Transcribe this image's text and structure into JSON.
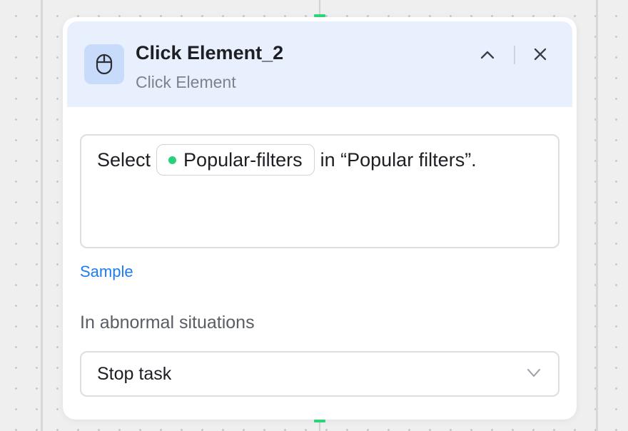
{
  "node": {
    "title": "Click Element_2",
    "subtitle": "Click Element",
    "icon": "mouse-icon"
  },
  "header_controls": {
    "collapse_icon": "chevron-up-icon",
    "close_icon": "close-icon"
  },
  "action": {
    "prefix": "Select",
    "chip_label": "Popular-filters",
    "chip_status_color": "#26d07c",
    "suffix": "in “Popular filters”."
  },
  "sample_link": "Sample",
  "abnormal": {
    "label": "In abnormal situations",
    "selected": "Stop task",
    "dropdown_icon": "chevron-down-icon"
  },
  "colors": {
    "header_bg": "#e8f0fd",
    "icon_bg": "#c9dbfa",
    "link": "#1e7cf2",
    "port": "#2ed47a"
  }
}
